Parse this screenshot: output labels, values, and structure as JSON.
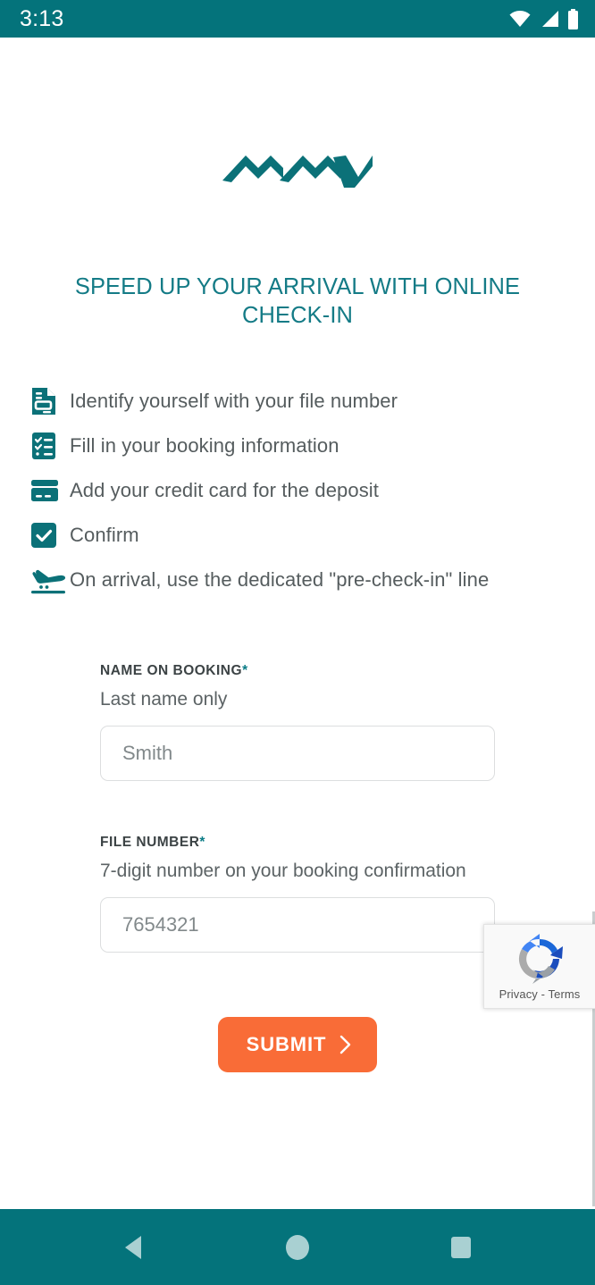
{
  "status_bar": {
    "time": "3:13",
    "icons": [
      "wifi-icon",
      "cellular-signal-icon",
      "battery-icon"
    ]
  },
  "brand": {
    "logo_alt": "MMV",
    "teal": "#04737B",
    "heading_teal": "#147B86",
    "orange": "#F96C37"
  },
  "main": {
    "heading": "SPEED UP YOUR ARRIVAL WITH ONLINE CHECK-IN",
    "steps": [
      {
        "icon": "document-icon",
        "text": "Identify yourself with your file number"
      },
      {
        "icon": "checklist-icon",
        "text": "Fill in your booking information"
      },
      {
        "icon": "credit-card-icon",
        "text": "Add your credit card for the deposit"
      },
      {
        "icon": "checkbox-check-icon",
        "text": "Confirm"
      },
      {
        "icon": "plane-landing-icon",
        "text": "On arrival, use the dedicated \"pre-check-in\" line"
      }
    ]
  },
  "form": {
    "name_field": {
      "label": "NAME ON BOOKING",
      "required_mark": "*",
      "hint": "Last name only",
      "placeholder": "Smith",
      "value": ""
    },
    "file_field": {
      "label": "FILE NUMBER",
      "required_mark": "*",
      "hint": "7-digit number on your booking confirmation",
      "placeholder": "7654321",
      "value": ""
    },
    "submit_label": "SUBMIT",
    "submit_icon": "chevron-right-icon"
  },
  "recaptcha": {
    "icon": "recaptcha-logo-icon",
    "text": "Privacy - Terms"
  },
  "nav_bar": {
    "back": "back-triangle-icon",
    "home": "home-circle-icon",
    "recents": "recents-square-icon"
  }
}
